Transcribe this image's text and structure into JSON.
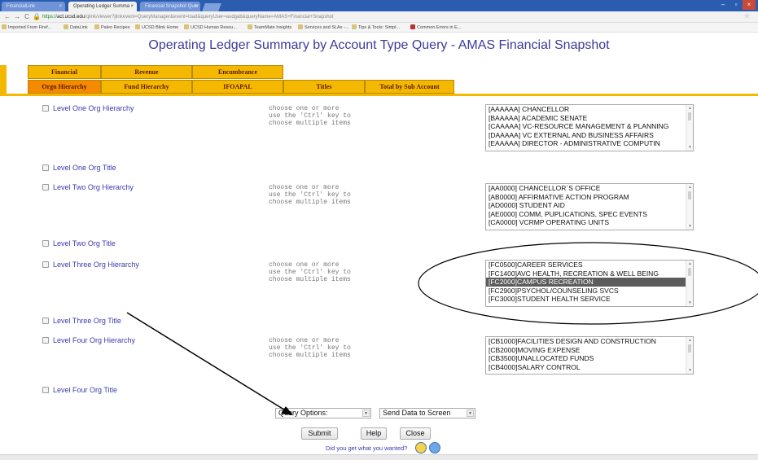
{
  "browser": {
    "tabs": [
      "FinancialLink",
      "Operating Ledger Summa",
      "Financial Snapshot Quer"
    ],
    "url_scheme": "https://",
    "url_host": "act.ucsd.edu",
    "url_path": "/qlink/viewer?jlinkevent=QueryManager&event=load&queryUser=audgab&queryName=AMAS+Financial+Snapshot",
    "bookmarks": [
      "Imported From Firef...",
      "DataLink",
      "Paleo Recipes",
      "UCSD Blink Home",
      "UCSD Human Resou...",
      "TeamMate Insights",
      "Services and SLAs -...",
      "Tips & Tools: Simpl...",
      "Common Errors in E..."
    ]
  },
  "page": {
    "title": "Operating Ledger Summary by Account Type Query - AMAS Financial Snapshot"
  },
  "nav": {
    "top_tabs": [
      "Financial",
      "Revenue",
      "Encumbrance"
    ],
    "bottom_tabs": [
      "Orgn Hierarchy",
      "Fund Hierarchy",
      "IFOAPAL",
      "Titles",
      "Total by Sub Account"
    ]
  },
  "hint_text": "choose one or more\nuse the 'Ctrl' key to\nchoose multiple items",
  "rows": {
    "level1_hierarchy": "Level One Org Hierarchy",
    "level1_title": "Level One Org Title",
    "level2_hierarchy": "Level Two Org Hierarchy",
    "level2_title": "Level Two Org Title",
    "level3_hierarchy": "Level Three Org Hierarchy",
    "level3_title": "Level Three Org Title",
    "level4_hierarchy": "Level Four Org Hierarchy",
    "level4_title": "Level Four Org Title"
  },
  "lists": {
    "level1": [
      "[AAAAAA] CHANCELLOR",
      "[BAAAAA] ACADEMIC SENATE",
      "[CAAAAA] VC-RESOURCE MANAGEMENT & PLANNING",
      "[DAAAAA] VC EXTERNAL AND BUSINESS AFFAIRS",
      "[EAAAAA] DIRECTOR - ADMINISTRATIVE COMPUTIN"
    ],
    "level2": [
      "[AA0000] CHANCELLOR`S OFFICE",
      "[AB0000] AFFIRMATIVE ACTION PROGRAM",
      "[AD0000] STUDENT AID",
      "[AE0000] COMM, PUPLICATIONS, SPEC EVENTS",
      "[CA0000] VCRMP OPERATING UNITS"
    ],
    "level3": [
      "[FC0500]CAREER SERVICES",
      "[FC1400]AVC HEALTH, RECREATION & WELL BEING",
      "[FC2000]CAMPUS RECREATION",
      "[FC2900]PSYCHOL/COUNSELING SVCS",
      "[FC3000]STUDENT HEALTH SERVICE"
    ],
    "level3_selected": 2,
    "level4": [
      "[CB1000]FACILITIES DESIGN AND CONSTRUCTION",
      "[CB2000]MOVING EXPENSE",
      "[CB3500]UNALLOCATED FUNDS",
      "[CB4000]SALARY CONTROL"
    ]
  },
  "controls": {
    "query_options": "Query Options:",
    "send_data": "Send Data to Screen",
    "submit": "Submit",
    "help": "Help",
    "close": "Close",
    "feedback": "Did you get what you wanted?"
  },
  "colors": {
    "tab_yellow": "#f5b800",
    "tab_orange": "#f58a00",
    "link_blue": "#3a3ab0",
    "title_blue": "#3a3a9c",
    "selected_option": "#5c5c5c"
  },
  "icons": [
    "back-arrow-icon",
    "forward-arrow-icon",
    "reload-icon",
    "lock-icon",
    "bookmark-star-icon",
    "happy-face-icon",
    "sad-face-icon"
  ]
}
